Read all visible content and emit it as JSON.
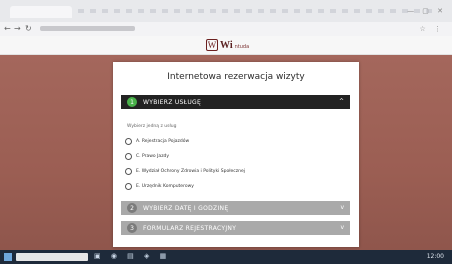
{
  "browser": {
    "tab_title": "",
    "url": "",
    "window_controls": "— ▢ ✕",
    "nav_back": "←",
    "nav_forward": "→",
    "nav_reload": "↻",
    "toolbar_icons": "☆ ⋮"
  },
  "site": {
    "logo_mark": "W",
    "logo_text": "Wi",
    "logo_small": "ntuda"
  },
  "card": {
    "title": "Internetowa rezerwacja wizyty",
    "section_label": "Wybierz jedną z usług",
    "steps": [
      {
        "number": "1",
        "label": "WYBIERZ USŁUGĘ",
        "chevron": "^"
      },
      {
        "number": "2",
        "label": "WYBIERZ DATĘ I GODZINĘ",
        "chevron": "v"
      },
      {
        "number": "3",
        "label": "FORMULARZ REJESTRACYJNY",
        "chevron": "v"
      }
    ],
    "options": [
      {
        "label": "A. Rejestracja Pojazdów"
      },
      {
        "label": "C. Prawo Jazdy"
      },
      {
        "label": "E. Wydział Ochrony Zdrowia i Polityki Społecznej"
      },
      {
        "label": "E. Urzędnik Komputerowy"
      }
    ]
  },
  "taskbar": {
    "icons": "▣ ◉ ▤ ◈ ▦",
    "clock": "12:00"
  }
}
